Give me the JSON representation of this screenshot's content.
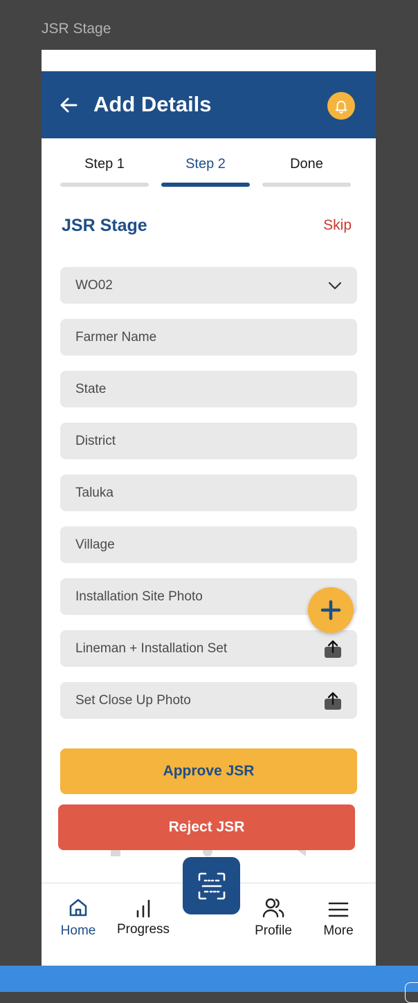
{
  "canvas": {
    "label": "JSR Stage"
  },
  "appbar": {
    "title": "Add Details"
  },
  "steps": [
    {
      "label": "Step 1",
      "active": false
    },
    {
      "label": "Step 2",
      "active": true
    },
    {
      "label": "Done",
      "active": false
    }
  ],
  "section": {
    "title": "JSR Stage",
    "skip_label": "Skip"
  },
  "form": {
    "work_order": {
      "value": "WO02"
    },
    "farmer_name": {
      "placeholder": "Farmer Name"
    },
    "state": {
      "placeholder": "State"
    },
    "district": {
      "placeholder": "District"
    },
    "taluka": {
      "placeholder": "Taluka"
    },
    "village": {
      "placeholder": "Village"
    },
    "installation_site_photo": {
      "placeholder": "Installation Site Photo"
    },
    "lineman_installation_set": {
      "placeholder": "Lineman + Installation Set"
    },
    "set_close_up_photo": {
      "placeholder": "Set Close Up Photo"
    }
  },
  "actions": {
    "approve_label": "Approve JSR",
    "reject_label": "Reject JSR"
  },
  "bottom_nav": {
    "items": [
      {
        "label": "Home",
        "icon": "home-icon",
        "active": true
      },
      {
        "label": "Progress",
        "icon": "bar-chart-icon",
        "active": false
      },
      {
        "label": "Profile",
        "icon": "users-icon",
        "active": false
      },
      {
        "label": "More",
        "icon": "menu-icon",
        "active": false
      }
    ],
    "center_icon": "scan-icon"
  },
  "colors": {
    "primary": "#1e4e87",
    "accent": "#f4b43d",
    "danger": "#e05a48",
    "skip": "#c83a2e",
    "field_bg": "#e9e9e9"
  }
}
